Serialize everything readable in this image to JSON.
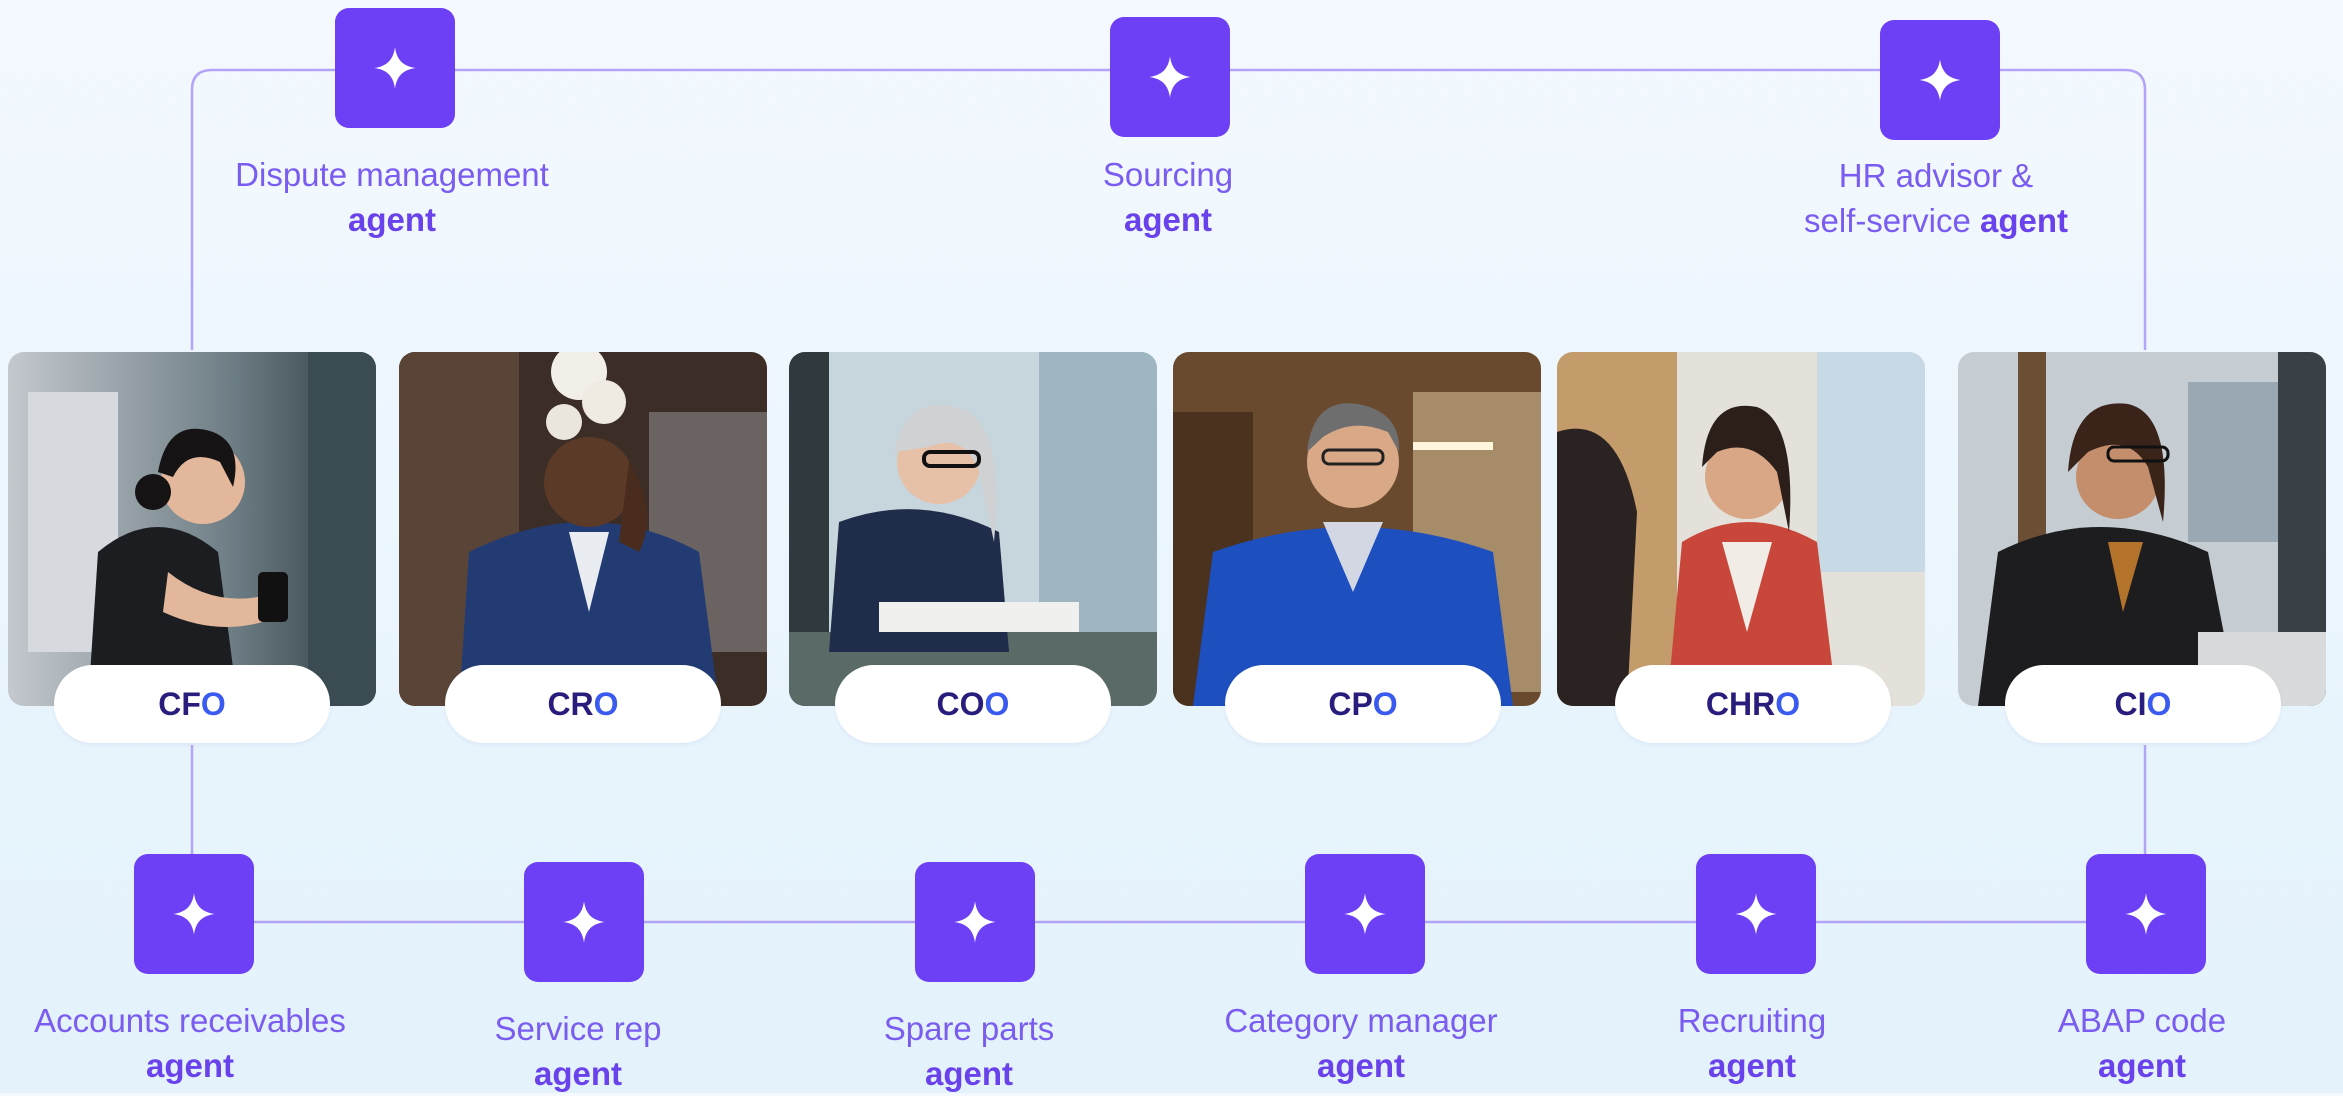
{
  "colors": {
    "accent": "#6d3ff5",
    "label": "#7a5cf0",
    "role_text": "#281c7c",
    "role_highlight": "#3b5bf0",
    "connector": "#b3a4f7"
  },
  "top_agents": [
    {
      "icon": "sparkle-icon",
      "line1": "Dispute management",
      "line2_bold": "agent",
      "line2_prefix": ""
    },
    {
      "icon": "sparkle-icon",
      "line1": "Sourcing",
      "line2_bold": "agent",
      "line2_prefix": ""
    },
    {
      "icon": "sparkle-icon",
      "line1": "HR advisor &",
      "line2_prefix": "self-service ",
      "line2_bold": "agent"
    }
  ],
  "roles": [
    {
      "prefix": "CF",
      "last": "O"
    },
    {
      "prefix": "CR",
      "last": "O"
    },
    {
      "prefix": "CO",
      "last": "O"
    },
    {
      "prefix": "CP",
      "last": "O"
    },
    {
      "prefix": "CHR",
      "last": "O"
    },
    {
      "prefix": "CI",
      "last": "O"
    }
  ],
  "bottom_agents": [
    {
      "icon": "sparkle-icon",
      "line1": "Accounts receivables",
      "line2_bold": "agent"
    },
    {
      "icon": "sparkle-icon",
      "line1": "Service rep",
      "line2_bold": "agent"
    },
    {
      "icon": "sparkle-icon",
      "line1": "Spare parts",
      "line2_bold": "agent"
    },
    {
      "icon": "sparkle-icon",
      "line1": "Category manager",
      "line2_bold": "agent"
    },
    {
      "icon": "sparkle-icon",
      "line1": "Recruiting",
      "line2_bold": "agent"
    },
    {
      "icon": "sparkle-icon",
      "line1": "ABAP code",
      "line2_bold": "agent"
    }
  ]
}
